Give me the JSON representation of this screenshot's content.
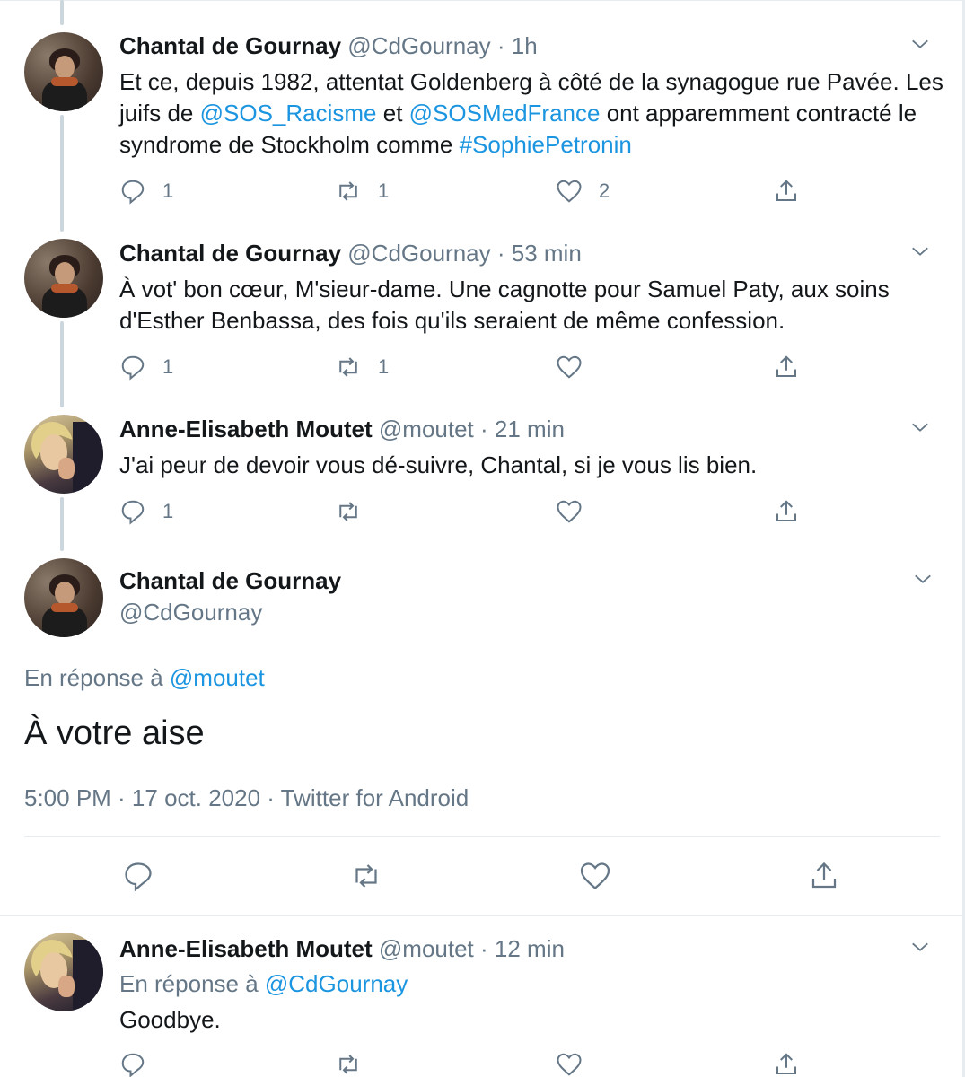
{
  "tweets": [
    {
      "name": "Chantal de Gournay",
      "handle": "@CdGournay",
      "time": "· 1h",
      "text_parts": [
        "Et ce, depuis 1982, attentat Goldenberg à côté de la synagogue rue Pavée. Les juifs de ",
        "@SOS_Racisme",
        " et ",
        "@SOSMedFrance",
        " ont apparemment contracté le syndrome de Stockholm comme ",
        "#SophiePetronin"
      ],
      "replies": "1",
      "retweets": "1",
      "likes": "2"
    },
    {
      "name": "Chantal de Gournay",
      "handle": "@CdGournay",
      "time": "· 53 min",
      "text": "À vot' bon cœur, M'sieur-dame. Une cagnotte pour Samuel Paty, aux soins d'Esther Benbassa, des fois qu'ils seraient de même confession.",
      "replies": "1",
      "retweets": "1",
      "likes": ""
    },
    {
      "name": "Anne-Elisabeth Moutet",
      "handle": "@moutet",
      "time": "· 21 min",
      "text": "J'ai peur de devoir vous dé-suivre, Chantal, si je vous lis bien.",
      "replies": "1",
      "retweets": "",
      "likes": ""
    }
  ],
  "focused": {
    "name": "Chantal de Gournay",
    "handle": "@CdGournay",
    "reply_prefix": "En réponse à ",
    "reply_to": "@moutet",
    "text": "À votre aise",
    "timestamp": "5:00 PM · 17 oct. 2020 · Twitter for Android"
  },
  "reply": {
    "name": "Anne-Elisabeth Moutet",
    "handle": "@moutet",
    "time": "· 12 min",
    "reply_prefix": "En réponse à ",
    "reply_to": "@CdGournay",
    "text": "Goodbye."
  },
  "colors": {
    "link": "#1b95e0",
    "secondary": "#657786",
    "text": "#14171a",
    "thread_line": "#ccd6dd"
  },
  "icons": [
    "reply-icon",
    "retweet-icon",
    "like-icon",
    "share-icon",
    "chevron-down-icon"
  ]
}
